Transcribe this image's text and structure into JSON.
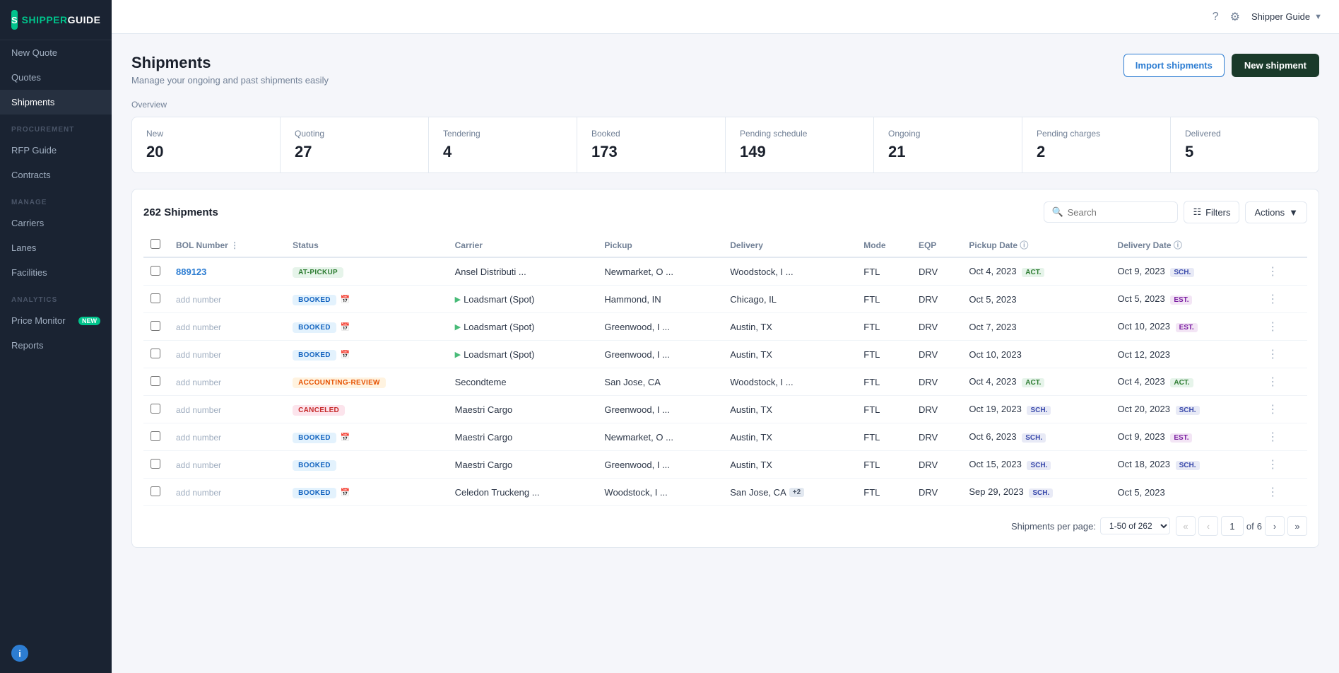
{
  "app": {
    "logo_text": "SHIPPER",
    "logo_accent": "GUIDE",
    "user_name": "Shipper Guide"
  },
  "sidebar": {
    "top_items": [
      {
        "label": "New Quote",
        "active": false
      },
      {
        "label": "Quotes",
        "active": false
      },
      {
        "label": "Shipments",
        "active": true
      }
    ],
    "sections": [
      {
        "label": "PROCUREMENT",
        "items": [
          {
            "label": "RFP Guide",
            "badge": null
          },
          {
            "label": "Contracts",
            "badge": null
          }
        ]
      },
      {
        "label": "MANAGE",
        "items": [
          {
            "label": "Carriers",
            "badge": null
          },
          {
            "label": "Lanes",
            "badge": null
          },
          {
            "label": "Facilities",
            "badge": null
          }
        ]
      },
      {
        "label": "ANALYTICS",
        "items": [
          {
            "label": "Price Monitor",
            "badge": "NEW"
          },
          {
            "label": "Reports",
            "badge": null
          }
        ]
      }
    ]
  },
  "page": {
    "title": "Shipments",
    "subtitle": "Manage your ongoing and past shipments easily",
    "btn_import": "Import shipments",
    "btn_new": "New shipment"
  },
  "overview": {
    "label": "Overview",
    "cards": [
      {
        "label": "New",
        "value": "20"
      },
      {
        "label": "Quoting",
        "value": "27"
      },
      {
        "label": "Tendering",
        "value": "4"
      },
      {
        "label": "Booked",
        "value": "173"
      },
      {
        "label": "Pending schedule",
        "value": "149"
      },
      {
        "label": "Ongoing",
        "value": "21"
      },
      {
        "label": "Pending charges",
        "value": "2"
      },
      {
        "label": "Delivered",
        "value": "5"
      }
    ]
  },
  "table": {
    "title": "262 Shipments",
    "search_placeholder": "Search",
    "btn_filters": "Filters",
    "btn_actions": "Actions",
    "columns": [
      "BOL Number",
      "Status",
      "Carrier",
      "Pickup",
      "Delivery",
      "Mode",
      "EQP",
      "Pickup Date",
      "Delivery Date",
      ""
    ],
    "rows": [
      {
        "bol": "889123",
        "bol_link": true,
        "status": "AT-PICKUP",
        "status_class": "badge-at-pickup",
        "carrier": "Ansel Distributi ...",
        "carrier_spot": false,
        "pickup": "Newmarket, O ...",
        "delivery": "Woodstock, I ...",
        "delivery_extra": null,
        "mode": "FTL",
        "eqp": "DRV",
        "pickup_date": "Oct 4, 2023",
        "pickup_tag": "ACT.",
        "pickup_tag_class": "tag-act",
        "delivery_date": "Oct 9, 2023",
        "delivery_tag": "SCH.",
        "delivery_tag_class": "tag-sch",
        "calendar": false
      },
      {
        "bol": "add number",
        "bol_link": false,
        "status": "BOOKED",
        "status_class": "badge-booked",
        "carrier": "Loadsmart (Spot)",
        "carrier_spot": true,
        "pickup": "Hammond, IN",
        "delivery": "Chicago, IL",
        "delivery_extra": null,
        "mode": "FTL",
        "eqp": "DRV",
        "pickup_date": "Oct 5, 2023",
        "pickup_tag": null,
        "pickup_tag_class": null,
        "delivery_date": "Oct 5, 2023",
        "delivery_tag": "EST.",
        "delivery_tag_class": "tag-est",
        "calendar": true
      },
      {
        "bol": "add number",
        "bol_link": false,
        "status": "BOOKED",
        "status_class": "badge-booked",
        "carrier": "Loadsmart (Spot)",
        "carrier_spot": true,
        "pickup": "Greenwood, I ...",
        "delivery": "Austin, TX",
        "delivery_extra": null,
        "mode": "FTL",
        "eqp": "DRV",
        "pickup_date": "Oct 7, 2023",
        "pickup_tag": null,
        "pickup_tag_class": null,
        "delivery_date": "Oct 10, 2023",
        "delivery_tag": "EST.",
        "delivery_tag_class": "tag-est",
        "calendar": true
      },
      {
        "bol": "add number",
        "bol_link": false,
        "status": "BOOKED",
        "status_class": "badge-booked",
        "carrier": "Loadsmart (Spot)",
        "carrier_spot": true,
        "pickup": "Greenwood, I ...",
        "delivery": "Austin, TX",
        "delivery_extra": null,
        "mode": "FTL",
        "eqp": "DRV",
        "pickup_date": "Oct 10, 2023",
        "pickup_tag": null,
        "pickup_tag_class": null,
        "delivery_date": "Oct 12, 2023",
        "delivery_tag": null,
        "delivery_tag_class": null,
        "calendar": true
      },
      {
        "bol": "add number",
        "bol_link": false,
        "status": "ACCOUNTING-REVIEW",
        "status_class": "badge-accounting-review",
        "carrier": "Secondteme",
        "carrier_spot": false,
        "pickup": "San Jose, CA",
        "delivery": "Woodstock, I ...",
        "delivery_extra": null,
        "mode": "FTL",
        "eqp": "DRV",
        "pickup_date": "Oct 4, 2023",
        "pickup_tag": "ACT.",
        "pickup_tag_class": "tag-act",
        "delivery_date": "Oct 4, 2023",
        "delivery_tag": "ACT.",
        "delivery_tag_class": "tag-act",
        "calendar": false
      },
      {
        "bol": "add number",
        "bol_link": false,
        "status": "CANCELED",
        "status_class": "badge-canceled",
        "carrier": "Maestri Cargo",
        "carrier_spot": false,
        "pickup": "Greenwood, I ...",
        "delivery": "Austin, TX",
        "delivery_extra": null,
        "mode": "FTL",
        "eqp": "DRV",
        "pickup_date": "Oct 19, 2023",
        "pickup_tag": "SCH.",
        "pickup_tag_class": "tag-sch",
        "delivery_date": "Oct 20, 2023",
        "delivery_tag": "SCH.",
        "delivery_tag_class": "tag-sch",
        "calendar": false
      },
      {
        "bol": "add number",
        "bol_link": false,
        "status": "BOOKED",
        "status_class": "badge-booked",
        "carrier": "Maestri Cargo",
        "carrier_spot": false,
        "pickup": "Newmarket, O ...",
        "delivery": "Austin, TX",
        "delivery_extra": null,
        "mode": "FTL",
        "eqp": "DRV",
        "pickup_date": "Oct 6, 2023",
        "pickup_tag": "SCH.",
        "pickup_tag_class": "tag-sch",
        "delivery_date": "Oct 9, 2023",
        "delivery_tag": "EST.",
        "delivery_tag_class": "tag-est",
        "calendar": true
      },
      {
        "bol": "add number",
        "bol_link": false,
        "status": "BOOKED",
        "status_class": "badge-booked",
        "carrier": "Maestri Cargo",
        "carrier_spot": false,
        "pickup": "Greenwood, I ...",
        "delivery": "Austin, TX",
        "delivery_extra": null,
        "mode": "FTL",
        "eqp": "DRV",
        "pickup_date": "Oct 15, 2023",
        "pickup_tag": "SCH.",
        "pickup_tag_class": "tag-sch",
        "delivery_date": "Oct 18, 2023",
        "delivery_tag": "SCH.",
        "delivery_tag_class": "tag-sch",
        "calendar": false
      },
      {
        "bol": "add number",
        "bol_link": false,
        "status": "BOOKED",
        "status_class": "badge-booked",
        "carrier": "Celedon Truckeng ...",
        "carrier_spot": false,
        "pickup": "Woodstock, I ...",
        "delivery": "San Jose, CA",
        "delivery_extra": "+2",
        "mode": "FTL",
        "eqp": "DRV",
        "pickup_date": "Sep 29, 2023",
        "pickup_tag": "SCH.",
        "pickup_tag_class": "tag-sch",
        "delivery_date": "Oct 5, 2023",
        "delivery_tag": null,
        "delivery_tag_class": null,
        "calendar": true
      }
    ]
  },
  "pagination": {
    "label": "Shipments per page:",
    "range": "1-50 of 262",
    "page": "1",
    "total_pages": "6"
  }
}
